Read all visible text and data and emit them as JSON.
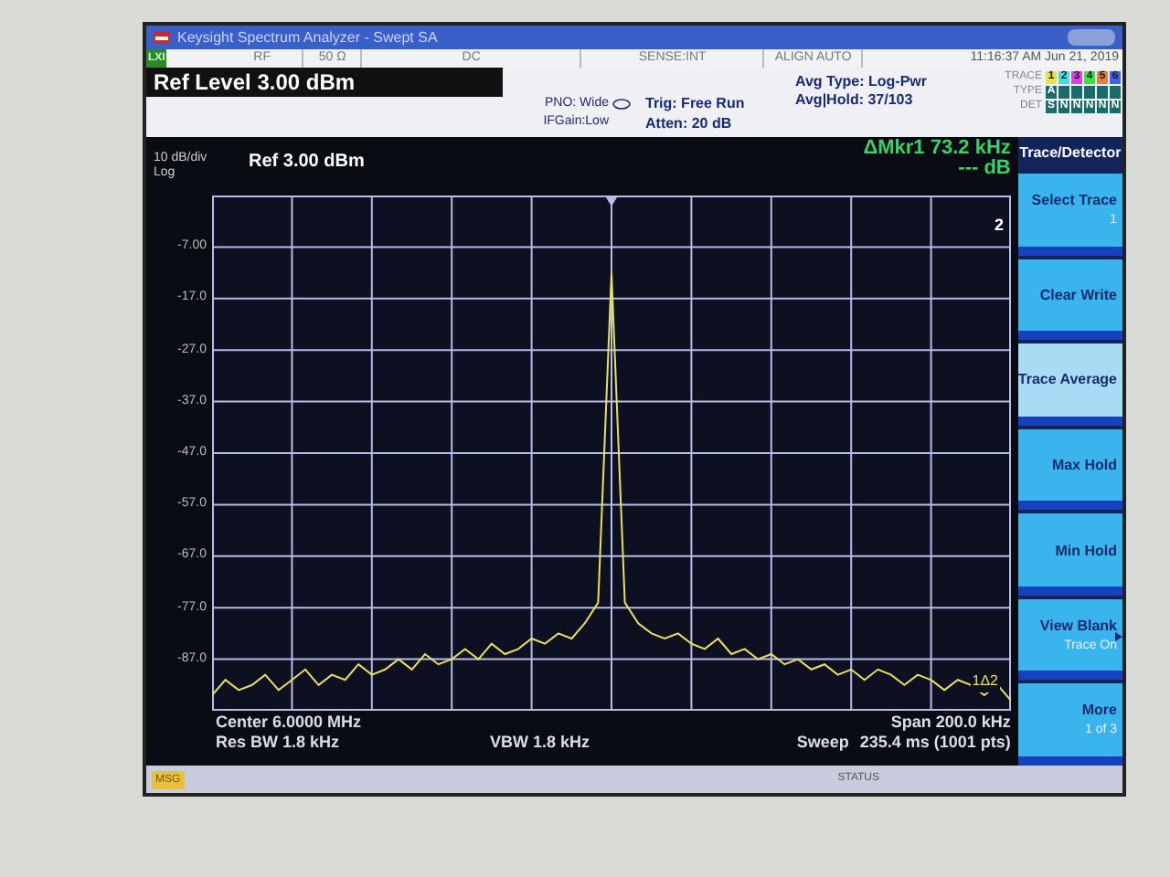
{
  "window": {
    "title": "Keysight Spectrum Analyzer - Swept SA"
  },
  "status_row": {
    "badge": "LXI",
    "cells": [
      "RF",
      "50 Ω",
      "DC",
      "SENSE:INT",
      "ALIGN AUTO"
    ],
    "datetime": "11:16:37 AM Jun 21, 2019"
  },
  "settings": {
    "ref_level": "Ref Level 3.00 dBm",
    "pno": "PNO: Wide",
    "ifgain": "IFGain:Low",
    "trig": "Trig: Free Run",
    "atten": "Atten: 20 dB",
    "avg_type": "Avg Type: Log-Pwr",
    "avg_hold": "Avg|Hold: 37/103"
  },
  "trace_panel": {
    "trace_label": "TRACE",
    "type_label": "TYPE",
    "det_label": "DET",
    "traces": [
      {
        "number": "1",
        "color": "#f0e040",
        "type": "A",
        "det": "S"
      },
      {
        "number": "2",
        "color": "#40e0e0",
        "det": "N"
      },
      {
        "number": "3",
        "color": "#e040e0",
        "det": "N"
      },
      {
        "number": "4",
        "color": "#40e040",
        "det": "N"
      },
      {
        "number": "5",
        "color": "#e08040",
        "det": "N"
      },
      {
        "number": "6",
        "color": "#4060f0",
        "det": "N"
      }
    ]
  },
  "display": {
    "scale": "10 dB/div",
    "scale_type": "Log",
    "ref": "Ref 3.00 dBm",
    "marker_freq": "ΔMkr1 73.2 kHz",
    "marker_level": "--- dB",
    "marker_ref_label": "2",
    "marker_label": "1Δ2",
    "chart_data": {
      "type": "line",
      "grid": true,
      "ylim": [
        -97,
        3
      ],
      "yticks": [
        {
          "value": -7,
          "label": "-7.00"
        },
        {
          "value": -17,
          "label": "-17.0"
        },
        {
          "value": -27,
          "label": "-27.0"
        },
        {
          "value": -37,
          "label": "-37.0"
        },
        {
          "value": -47,
          "label": "-47.0"
        },
        {
          "value": -57,
          "label": "-57.0"
        },
        {
          "value": -67,
          "label": "-67.0"
        },
        {
          "value": -77,
          "label": "-77.0"
        },
        {
          "value": -87,
          "label": "-87.0"
        }
      ],
      "categories": [
        null,
        null,
        null,
        null,
        null,
        null,
        null,
        null,
        null,
        null,
        null,
        null,
        null,
        null,
        null,
        null,
        null,
        null,
        null,
        null,
        null,
        null,
        null,
        null,
        null,
        null,
        null,
        null,
        null,
        null,
        null,
        null,
        null,
        null,
        null,
        null,
        null,
        null,
        null,
        null,
        null,
        null,
        null,
        null,
        null,
        null,
        null,
        null,
        null,
        null,
        null,
        null,
        null,
        null,
        null,
        null,
        null,
        null,
        null,
        null,
        null
      ],
      "series": [
        {
          "color": "#e8e060",
          "values": [
            -94,
            -91,
            -93,
            -92,
            -90,
            -93,
            -91,
            -89,
            -92,
            -90,
            -91,
            -88,
            -90,
            -89,
            -87,
            -89,
            -86,
            -88,
            -87,
            -85,
            -87,
            -84,
            -86,
            -85,
            -83,
            -84,
            -82,
            -83,
            -80,
            -76,
            -12,
            -76,
            -80,
            -82,
            -83,
            -82,
            -84,
            -85,
            -83,
            -86,
            -85,
            -87,
            -86,
            -88,
            -87,
            -89,
            -88,
            -90,
            -89,
            -91,
            -89,
            -90,
            -92,
            -90,
            -91,
            -93,
            -91,
            -92,
            -94,
            -92,
            -95
          ]
        }
      ]
    }
  },
  "footer": {
    "center": "Center 6.0000 MHz",
    "span": "Span 200.0 kHz",
    "res_bw": "Res BW 1.8 kHz",
    "vbw": "VBW 1.8 kHz",
    "sweep_label": "Sweep",
    "sweep": "235.4 ms (1001 pts)"
  },
  "message_bar": {
    "msg": "MSG",
    "status": "STATUS"
  },
  "softkeys": {
    "title": "Trace/Detector",
    "keys": [
      {
        "label": "Select Trace",
        "sub": "1",
        "selected": false,
        "submenu": false
      },
      {
        "label": "Clear Write",
        "selected": false,
        "submenu": false
      },
      {
        "label": "Trace Average",
        "selected": true,
        "submenu": false
      },
      {
        "label": "Max Hold",
        "selected": false,
        "submenu": false
      },
      {
        "label": "Min Hold",
        "selected": false,
        "submenu": false
      },
      {
        "label": "View Blank",
        "sub": "Trace On",
        "selected": false,
        "submenu": true
      },
      {
        "label": "More",
        "sub": "1 of 3",
        "selected": false,
        "submenu": false
      }
    ]
  }
}
